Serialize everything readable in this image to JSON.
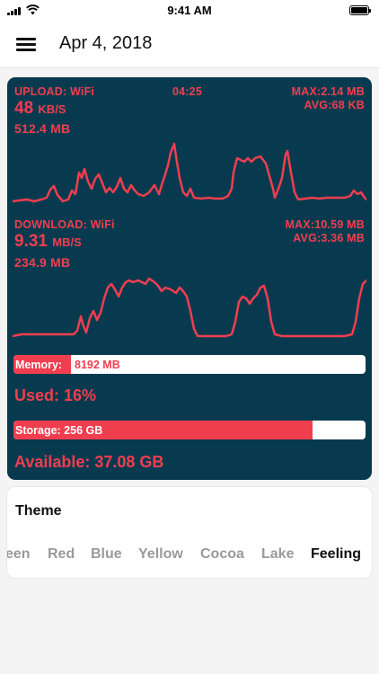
{
  "status_bar": {
    "time": "9:41 AM"
  },
  "nav": {
    "title": "Apr 4, 2018"
  },
  "upload": {
    "label": "UPLOAD: WiFi",
    "elapsed": "04:25",
    "max": "MAX:2.14 MB",
    "avg": "AVG:68 KB",
    "rate": "48",
    "rate_unit": "KB/S",
    "total": "512.4 MB"
  },
  "download": {
    "label": "DOWNLOAD: WiFi",
    "max": "MAX:10.59 MB",
    "avg": "AVG:3.36 MB",
    "rate": "9.31",
    "rate_unit": "MB/S",
    "total": "234.9 MB"
  },
  "memory": {
    "label": "Memory:",
    "value": "8192 MB",
    "used": "Used: 16%",
    "used_fraction": 0.16
  },
  "storage": {
    "label": "Storage: 256 GB",
    "available": "Available: 37.08 GB",
    "used_fraction": 0.85
  },
  "theme": {
    "title": "Theme",
    "options": [
      "een",
      "Red",
      "Blue",
      "Yellow",
      "Cocoa",
      "Lake",
      "Feeling"
    ],
    "selected": "Feeling"
  },
  "colors": {
    "panel": "#083a4f",
    "accent": "#f03e4f"
  }
}
